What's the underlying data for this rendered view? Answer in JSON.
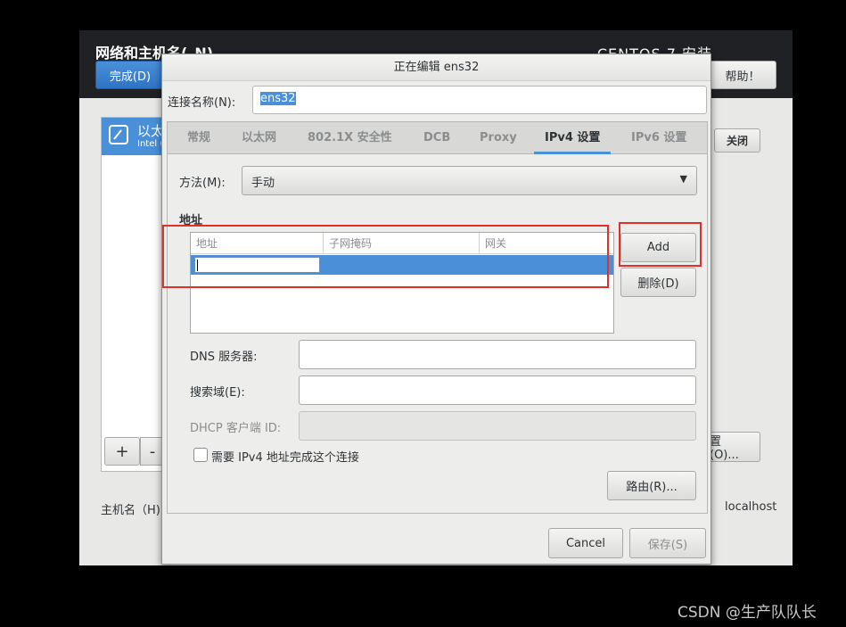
{
  "installer": {
    "title": "网络和主机名(_N)",
    "product": "CENTOS 7 安装",
    "done_label": "完成(D)",
    "help_label": "帮助！",
    "device_name": "以太",
    "device_sub": "Intel (",
    "plus_label": "+",
    "minus_label": "-",
    "close_label": "关闭",
    "config_label": "置(O)...",
    "hostname_label": "主机名（H)",
    "hostname_value": "localhost"
  },
  "dialog": {
    "title": "正在编辑 ens32",
    "conn_label": "连接名称(N):",
    "conn_value": "ens32",
    "tabs": [
      "常规",
      "以太网",
      "802.1X 安全性",
      "DCB",
      "Proxy",
      "IPv4 设置",
      "IPv6 设置"
    ],
    "active_tab": "IPv4 设置",
    "method_label": "方法(M):",
    "method_value": "手动",
    "address_heading": "地址",
    "address_columns": [
      "地址",
      "子网掩码",
      "网关"
    ],
    "add_label": "Add",
    "delete_label": "删除(D)",
    "dns_label": "DNS 服务器:",
    "search_label": "搜索域(E):",
    "dhcp_label": "DHCP 客户端 ID:",
    "require_ipv4_label": "需要 IPv4 地址完成这个连接",
    "require_ipv4_checked": false,
    "routes_label": "路由(R)...",
    "cancel_label": "Cancel",
    "save_label": "保存(S)"
  },
  "colors": {
    "accent": "#4a90d9",
    "highlight_box": "#e0302c"
  },
  "watermark": "CSDN @生产队队长"
}
